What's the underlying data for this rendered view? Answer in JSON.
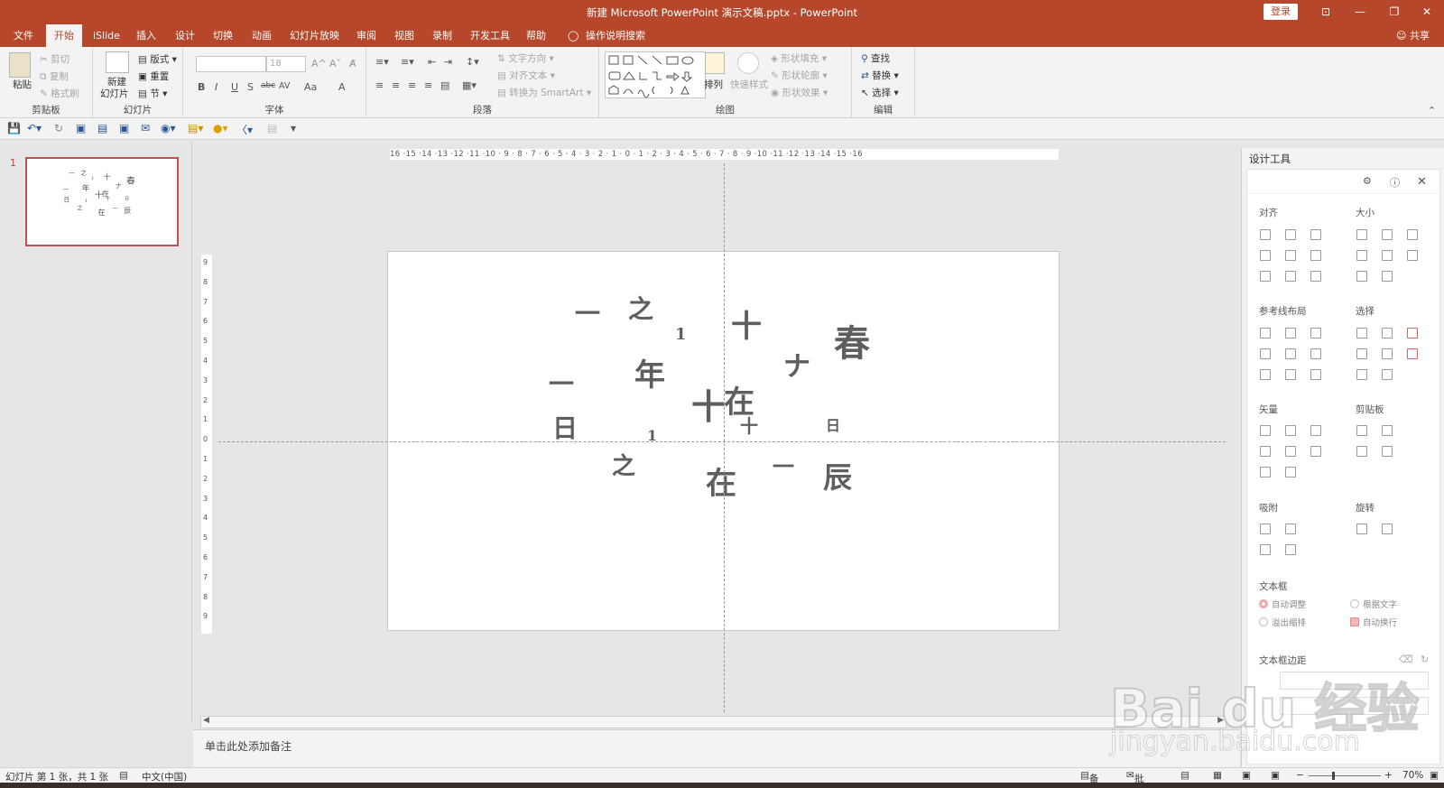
{
  "window": {
    "title": "新建 Microsoft PowerPoint 演示文稿.pptx  -  PowerPoint",
    "login": "登录",
    "controls": [
      "⊡",
      "—",
      "❐",
      "✕"
    ]
  },
  "tabs": [
    "文件",
    "开始",
    "iSlide",
    "插入",
    "设计",
    "切换",
    "动画",
    "幻灯片放映",
    "审阅",
    "视图",
    "录制",
    "开发工具",
    "帮助"
  ],
  "active_tab": "开始",
  "tell_me": "操作说明搜索",
  "share": "共享",
  "ribbon": {
    "clipboard": {
      "label": "剪贴板",
      "paste": "粘贴",
      "cut": "剪切",
      "copy": "复制",
      "format_painter": "格式刷"
    },
    "slides": {
      "label": "幻灯片",
      "new_slide_1": "新建",
      "new_slide_2": "幻灯片",
      "layout": "版式",
      "reset": "重置",
      "section": "节"
    },
    "font": {
      "label": "字体",
      "font_size": "18",
      "buttons": [
        "B",
        "I",
        "U",
        "S",
        "abc",
        "AV",
        "Aa",
        "A"
      ]
    },
    "paragraph": {
      "label": "段落",
      "text_direction": "文字方向",
      "align_text": "对齐文本",
      "smartart": "转换为 SmartArt"
    },
    "drawing": {
      "label": "绘图",
      "arrange": "排列",
      "quick_styles": "快速样式",
      "shape_fill": "形状填充",
      "shape_outline": "形状轮廓",
      "shape_effects": "形状效果"
    },
    "editing": {
      "label": "编辑",
      "find": "查找",
      "replace": "替换",
      "select": "选择"
    }
  },
  "slide_thumbnail_number": "1",
  "slide_text": [
    {
      "text": "一"
    },
    {
      "text": "之"
    },
    {
      "text": "1"
    },
    {
      "text": "十"
    },
    {
      "text": "春"
    },
    {
      "text": "一"
    },
    {
      "text": "年"
    },
    {
      "text": "ナ"
    },
    {
      "text": "十"
    },
    {
      "text": "在"
    },
    {
      "text": "日"
    },
    {
      "text": "1"
    },
    {
      "text": "十"
    },
    {
      "text": "日"
    },
    {
      "text": "之"
    },
    {
      "text": "在"
    },
    {
      "text": "一"
    },
    {
      "text": "辰"
    }
  ],
  "ruler": {
    "horizontal": "16 ·15 ·14 ·13 ·12 ·11 ·10 · 9 · 8 · 7 · 6 · 5 · 4 · 3 · 2 · 1 · 0 · 1 · 2 · 3 · 4 · 5 · 6 · 7 · 8 · 9 ·10 ·11 ·12 ·13 ·14 ·15 ·16",
    "vertical": [
      "9",
      "8",
      "7",
      "6",
      "5",
      "4",
      "3",
      "2",
      "1",
      "0",
      "1",
      "2",
      "3",
      "4",
      "5",
      "6",
      "7",
      "8",
      "9"
    ]
  },
  "notes_placeholder": "单击此处添加备注",
  "design_panel": {
    "title": "设计工具",
    "sections": {
      "align": "对齐",
      "size": "大小",
      "guide_layout": "参考线布局",
      "select": "选择",
      "vector": "矢量",
      "clipboard": "剪贴板",
      "snap": "吸附",
      "rotate": "旋转",
      "textbox": "文本框",
      "textbox_margin": "文本框边距"
    },
    "textbox_options": {
      "auto_fit": "自动调整",
      "fit_text": "根据文字",
      "overflow_shrink": "溢出缩排",
      "auto_wrap": "自动换行"
    }
  },
  "status": {
    "slide_count": "幻灯片 第 1 张，共 1 张",
    "language": "中文(中国)",
    "notes": "备注",
    "comments": "批注",
    "zoom": "70%"
  },
  "watermark": {
    "line1": "Bai du 经验",
    "line2": "jingyan.baidu.com"
  },
  "colors": {
    "accent": "#b7472a",
    "ribbon_bg": "#f3f3f3",
    "canvas_bg": "#e6e6e6",
    "slide_text": "#5e5e5e"
  }
}
